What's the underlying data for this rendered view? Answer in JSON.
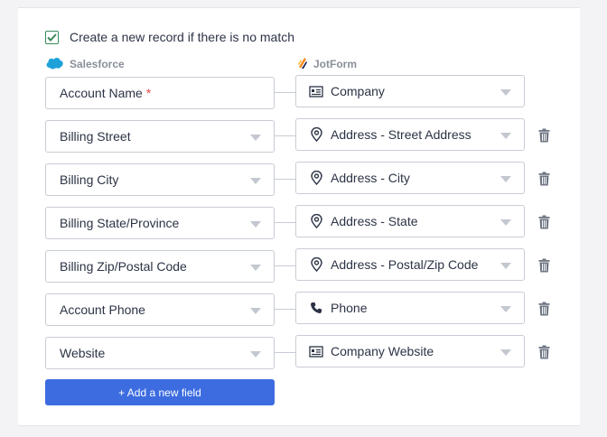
{
  "match_option": {
    "label": "Create a new record if there is no match",
    "checked": true
  },
  "columns": {
    "left": "Salesforce",
    "right": "JotForm"
  },
  "rows": [
    {
      "left": "Account Name",
      "required": true,
      "right": "Company",
      "right_icon": "building-card-icon",
      "deletable": false
    },
    {
      "left": "Billing Street",
      "required": false,
      "right": "Address - Street Address",
      "right_icon": "location-pin-icon",
      "deletable": true
    },
    {
      "left": "Billing City",
      "required": false,
      "right": "Address - City",
      "right_icon": "location-pin-icon",
      "deletable": true
    },
    {
      "left": "Billing State/Province",
      "required": false,
      "right": "Address - State",
      "right_icon": "location-pin-icon",
      "deletable": true
    },
    {
      "left": "Billing Zip/Postal Code",
      "required": false,
      "right": "Address - Postal/Zip Code",
      "right_icon": "location-pin-icon",
      "deletable": true
    },
    {
      "left": "Account Phone",
      "required": false,
      "right": "Phone",
      "right_icon": "phone-icon",
      "deletable": true
    },
    {
      "left": "Website",
      "required": false,
      "right": "Company Website",
      "right_icon": "building-card-icon",
      "deletable": true
    }
  ],
  "required_marker": "*",
  "add_button": "+ Add a new field",
  "colors": {
    "accent": "#3c6ce0",
    "required": "#e5484d",
    "check": "#3a8a5a"
  }
}
